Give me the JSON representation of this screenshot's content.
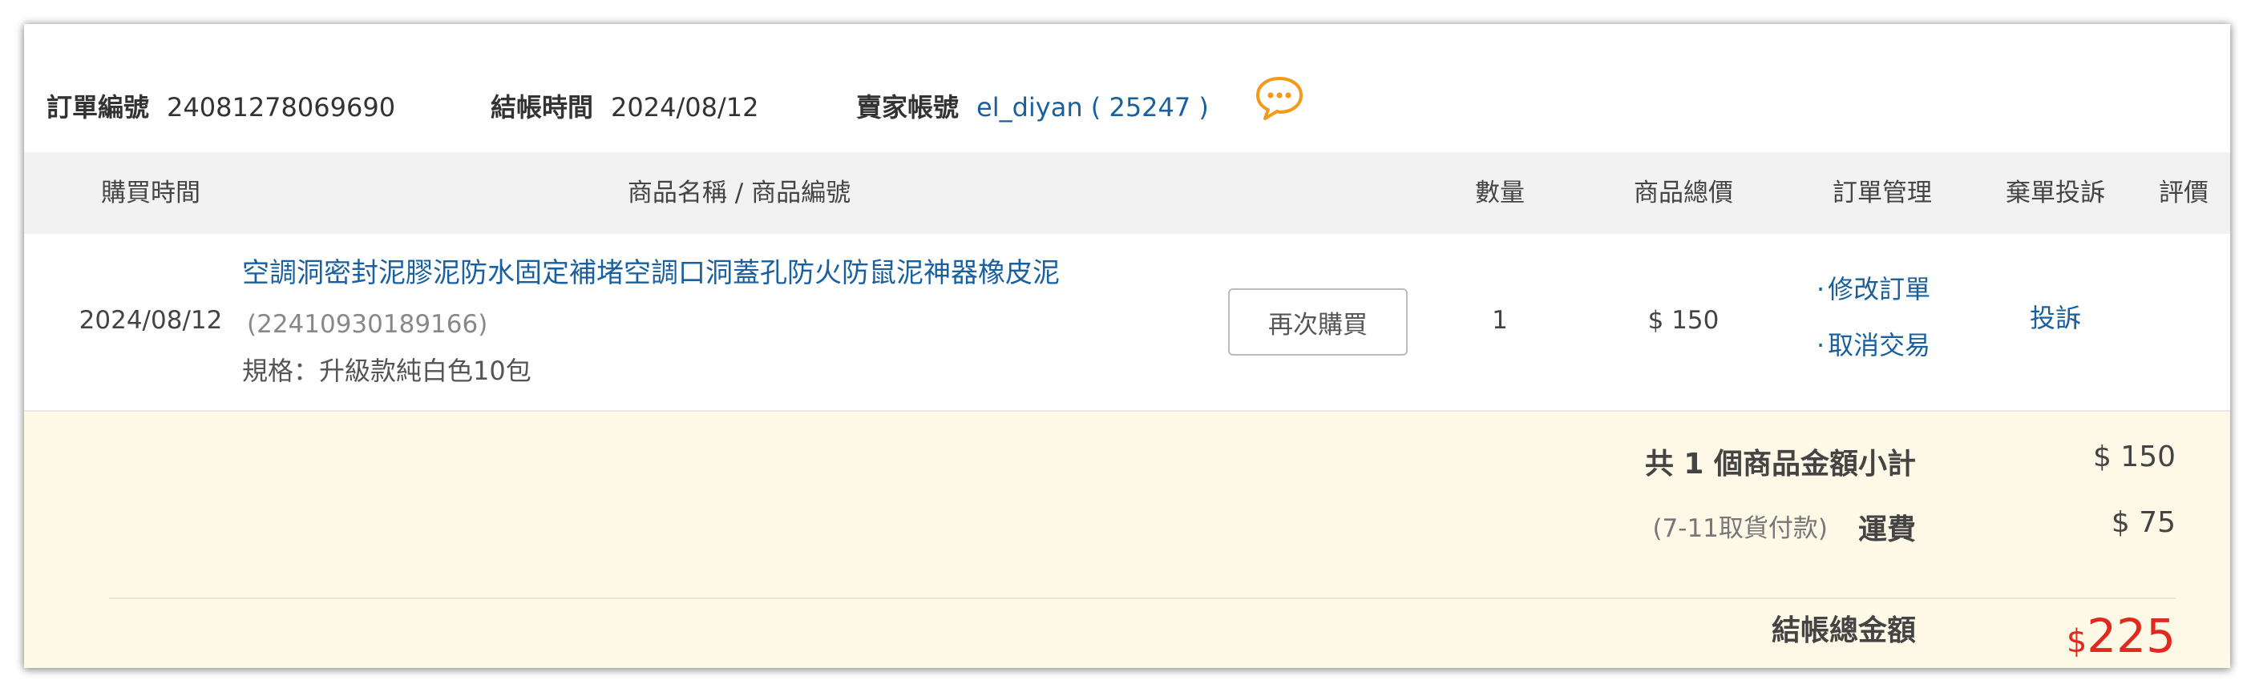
{
  "order": {
    "order_no_label": "訂單編號",
    "order_no": "24081278069690",
    "checkout_time_label": "結帳時間",
    "checkout_time": "2024/08/12",
    "seller_label": "賣家帳號",
    "seller_name": "el_diyan",
    "paren_open": "(",
    "seller_rating": "25247",
    "paren_close": ")",
    "chat_icon": "chat-bubble-icon"
  },
  "table": {
    "headers": {
      "purchase_time": "購買時間",
      "product": "商品名稱 / 商品編號",
      "quantity": "數量",
      "total_price": "商品總價",
      "order_management": "訂單管理",
      "abandon_complaint": "棄單投訴",
      "review": "評價"
    },
    "item": {
      "purchase_time": "2024/08/12",
      "product_name": "空調洞密封泥膠泥防水固定補堵空調口洞蓋孔防火防鼠泥神器橡皮泥",
      "product_id": "(22410930189166)",
      "spec": "規格：升級款純白色10包",
      "buy_again_label": "再次購買",
      "quantity": "1",
      "price": "$ 150",
      "bullet": "·",
      "modify_order": "修改訂單",
      "cancel_transaction": "取消交易",
      "complaint": "投訴"
    }
  },
  "summary": {
    "subtotal_label": "共 1 個商品金額小計",
    "subtotal_value": "$ 150",
    "shipping_note": "(7-11取貨付款)",
    "shipping_label": "運費",
    "shipping_value": "$ 75",
    "total_label": "結帳總金額",
    "total_currency": "$",
    "total_value": "225"
  },
  "colors": {
    "link": "#1a5f9e",
    "total": "#e02a20",
    "chat_icon": "#f39a1e",
    "summary_bg": "#fdf9e6",
    "header_bg": "#f2f2f2"
  }
}
